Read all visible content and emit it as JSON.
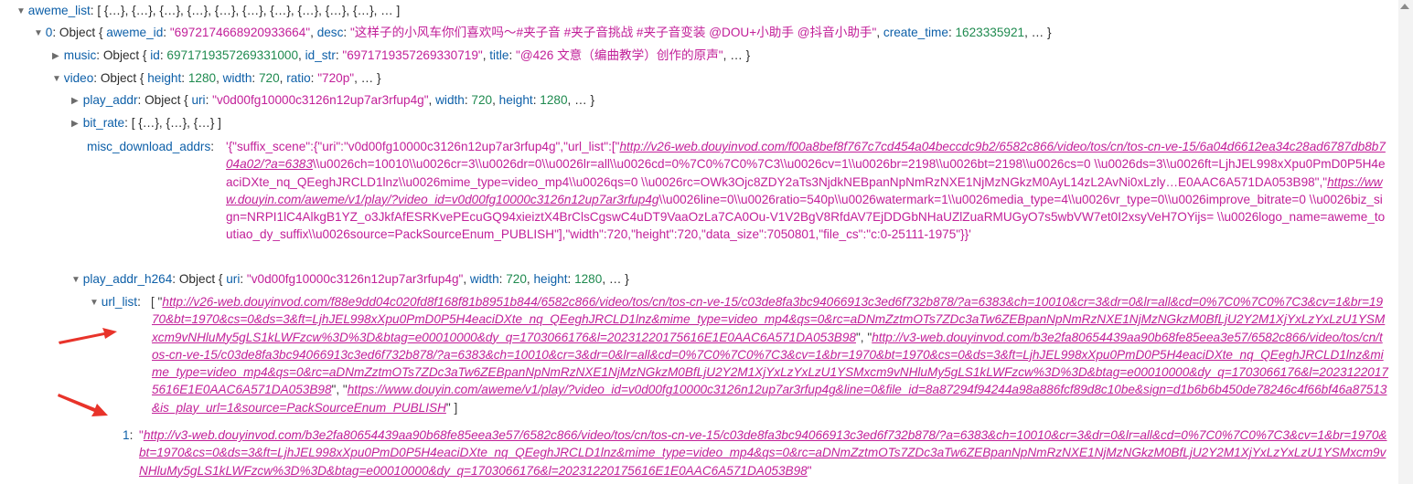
{
  "accent_colors": {
    "key": "#0d5fa8",
    "string": "#c22099",
    "number": "#1f8a4f",
    "arrow": "#e8332a"
  },
  "r0": {
    "key": "aweme_list",
    "rest": "[ {…}, {…}, {…}, {…}, {…}, {…}, {…}, {…}, {…}, {…}, … ]"
  },
  "r1": {
    "key": "0",
    "p1": "Object { ",
    "k1": "aweme_id",
    "v1": "\"6972174668920933664\"",
    "k2": "desc",
    "v2": "\"这样子的小风车你们喜欢吗～#夹子音 #夹子音挑战 #夹子音变装 @DOU+小助手 @抖音小助手\"",
    "k3": "create_time",
    "v3": "1623335921",
    "tail": ", … }"
  },
  "r2": {
    "key": "music",
    "p1": "Object { ",
    "k1": "id",
    "v1": "6971719357269331000",
    "k2": "id_str",
    "v2": "\"6971719357269330719\"",
    "k3": "title",
    "v3": "\"@426 文意（编曲教学）创作的原声\"",
    "tail": ", … }"
  },
  "r3": {
    "key": "video",
    "p1": "Object { ",
    "k1": "height",
    "v1": "1280",
    "k2": "width",
    "v2": "720",
    "k3": "ratio",
    "v3": "\"720p\"",
    "tail": ", … }"
  },
  "r4": {
    "key": "play_addr",
    "p1": "Object { ",
    "k1": "uri",
    "v1": "\"v0d00fg10000c3126n12up7ar3rfup4g\"",
    "k2": "width",
    "v2": "720",
    "k3": "height",
    "v3": "1280",
    "tail": ", … }"
  },
  "r5": {
    "key": "bit_rate",
    "rest": "[ {…}, {…}, {…} ]"
  },
  "r6": {
    "key": "misc_download_addrs",
    "s1": "'{\"suffix_scene\":{\"uri\":\"v0d00fg10000c3126n12up7ar3rfup4g\",\"url_list\":[\"",
    "u1": "http://v26-web.douyinvod.com/f00a8bef8f767c7cd454a04beccdc9b2/6582c866/video/tos/cn/tos-cn-ve-15/6a04d6612ea34c28ad6787db8b704a02/?a=6383",
    "s2": "\\\\u0026ch=10010\\\\u0026cr=3\\\\u0026dr=0\\\\u0026lr=all\\\\u0026cd=0%7C0%7C0%7C3\\\\u0026cv=1\\\\u0026br=2198\\\\u0026bt=2198\\\\u0026cs=0 \\\\u0026ds=3\\\\u0026ft=LjhJEL998xXpu0PmD0P5H4eaciDXte_nq_QEeghJRCLD1lnz\\\\u0026mime_type=video_mp4\\\\u0026qs=0 \\\\u0026rc=OWk3Ojc8ZDY2aTs3NjdkNEBpanNpNmRzNXE1NjMzNGkzM0AyL14zL2AvNi0xLzly…E0AAC6A571DA053B98\",\"",
    "u2": "https://www.douyin.com/aweme/v1/play/?video_id=v0d00fg10000c3126n12up7ar3rfup4g",
    "s3": "\\\\u0026line=0\\\\u0026ratio=540p\\\\u0026watermark=1\\\\u0026media_type=4\\\\u0026vr_type=0\\\\u0026improve_bitrate=0 \\\\u0026biz_sign=NRPI1lC4AlkgB1YZ_o3JkfAfESRKvePEcuGQ94xieiztX4BrClsCgswC4uDT9VaaOzLa7CA0Ou-V1V2BgV8RfdAV7EjDDGbNHaUZlZuaRMUGyO7s5wbVW7et0I2xsyVeH7OYijs= \\\\u0026logo_name=aweme_toutiao_dy_suffix\\\\u0026source=PackSourceEnum_PUBLISH\"],\"width\":720,\"height\":720,\"data_size\":7050801,\"file_cs\":\"c:0-25111-1975\"}}'"
  },
  "r7": {
    "key": "play_addr_h264",
    "p1": "Object { ",
    "k1": "uri",
    "v1": "\"v0d00fg10000c3126n12up7ar3rfup4g\"",
    "k2": "width",
    "v2": "720",
    "k3": "height",
    "v3": "1280",
    "tail": ", … }"
  },
  "r8": {
    "key": "url_list",
    "open": "[ \"",
    "u1": "http://v26-web.douyinvod.com/f88e9dd04c020fd8f168f81b8951b844/6582c866/video/tos/cn/tos-cn-ve-15/c03de8fa3bc94066913c3ed6f732b878/?a=6383&ch=10010&cr=3&dr=0&lr=all&cd=0%7C0%7C0%7C3&cv=1&br=1970&bt=1970&cs=0&ds=3&ft=LjhJEL998xXpu0PmD0P5H4eaciDXte_nq_QEeghJRCLD1lnz&mime_type=video_mp4&qs=0&rc=aDNmZztmOTs7ZDc3aTw6ZEBpanNpNmRzNXE1NjMzNGkzM0BfLjU2Y2M1XjYxLzYxLzU1YSMxcm9vNHluMy5gLS1kLWFzcw%3D%3D&btag=e00010000&dy_q=1703066176&l=20231220175616E1E0AAC6A571DA053B98",
    "mid1": "\", \"",
    "u2": "http://v3-web.douyinvod.com/b3e2fa80654439aa90b68fe85eea3e57/6582c866/video/tos/cn/tos-cn-ve-15/c03de8fa3bc94066913c3ed6f732b878/?a=6383&ch=10010&cr=3&dr=0&lr=all&cd=0%7C0%7C0%7C3&cv=1&br=1970&bt=1970&cs=0&ds=3&ft=LjhJEL998xXpu0PmD0P5H4eaciDXte_nq_QEeghJRCLD1lnz&mime_type=video_mp4&qs=0&rc=aDNmZztmOTs7ZDc3aTw6ZEBpanNpNmRzNXE1NjMzNGkzM0BfLjU2Y2M1XjYxLzYxLzU1YSMxcm9vNHluMy5gLS1kLWFzcw%3D%3D&btag=e00010000&dy_q=1703066176&l=20231220175616E1E0AAC6A571DA053B98",
    "mid2": "\", \"",
    "u3": "https://www.douyin.com/aweme/v1/play/?video_id=v0d00fg10000c3126n12up7ar3rfup4g&line=0&file_id=8a87294f94244a98a886fcf89d8c10be&sign=d1b6b6b450de78246c4f66bf46a87513&is_play_url=1&source=PackSourceEnum_PUBLISH",
    "close": "\" ]"
  },
  "r9": {
    "key": "1",
    "open": "\"",
    "u1": "http://v3-web.douyinvod.com/b3e2fa80654439aa90b68fe85eea3e57/6582c866/video/tos/cn/tos-cn-ve-15/c03de8fa3bc94066913c3ed6f732b878/?a=6383&ch=10010&cr=3&dr=0&lr=all&cd=0%7C0%7C0%7C3&cv=1&br=1970&bt=1970&cs=0&ds=3&ft=LjhJEL998xXpu0PmD0P5H4eaciDXte_nq_QEeghJRCLD1lnz&mime_type=video_mp4&qs=0&rc=aDNmZztmOTs7ZDc3aTw6ZEBpanNpNmRzNXE1NjMzNGkzM0BfLjU2Y2M1XjYxLzYxLzU1YSMxcm9vNHluMy5gLS1kLWFzcw%3D%3D&btag=e00010000&dy_q=1703066176&l=20231220175616E1E0AAC6A571DA053B98",
    "close": "\""
  }
}
